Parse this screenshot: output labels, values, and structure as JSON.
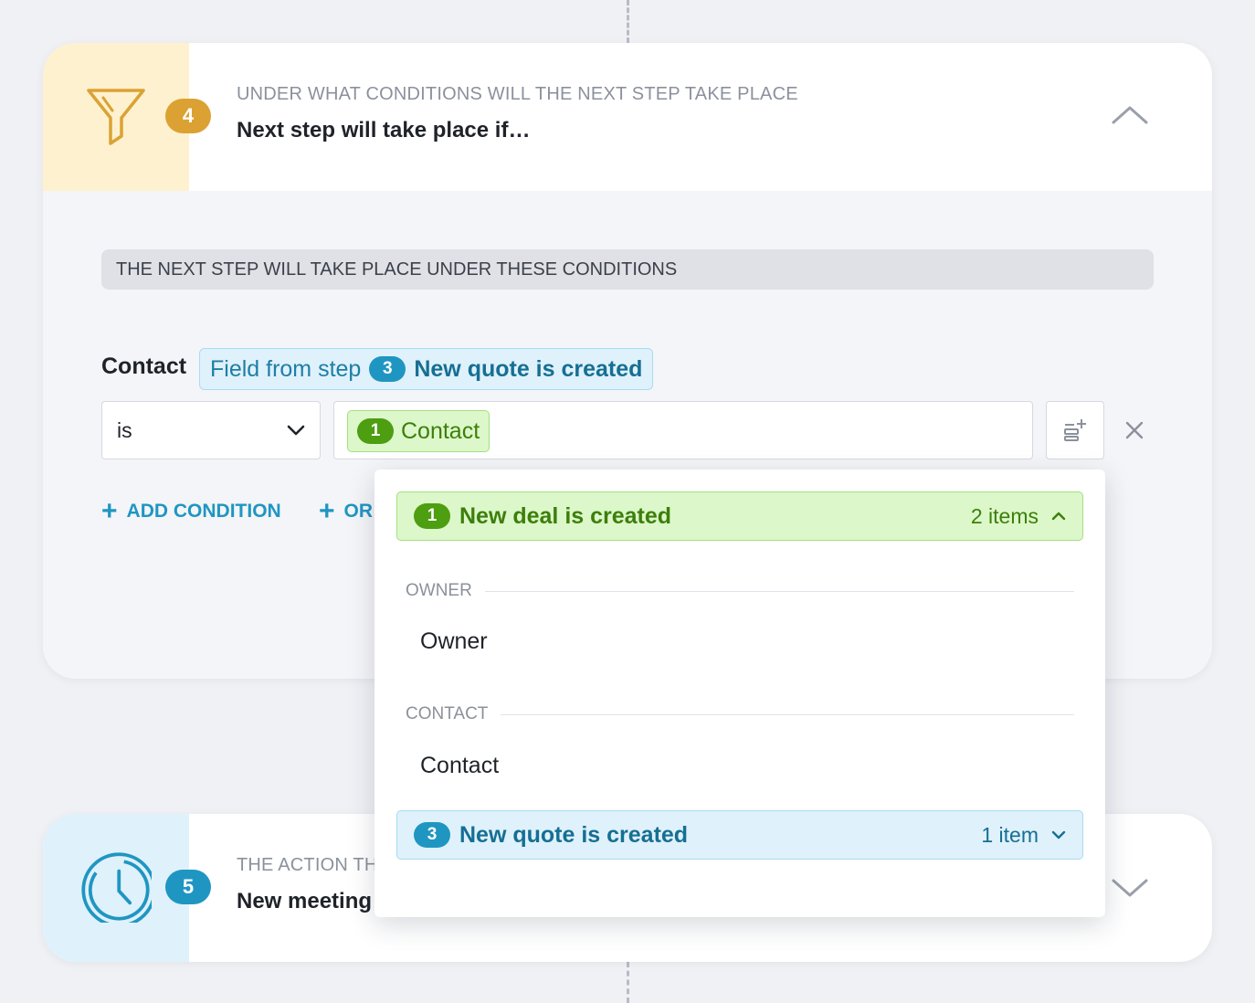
{
  "step4": {
    "number": "4",
    "icon": "funnel-icon",
    "subtitle": "UNDER WHAT CONDITIONS WILL THE NEXT STEP TAKE PLACE",
    "title": "Next step will take place if…",
    "section_header": "THE NEXT STEP WILL TAKE PLACE UNDER THESE CONDITIONS",
    "condition": {
      "field_label": "Contact",
      "field_source_prefix": "Field from step",
      "field_source_step": "3",
      "field_source_name": "New quote is created",
      "operator": "is",
      "value_step": "1",
      "value_label": "Contact"
    },
    "add_condition_label": "ADD CONDITION",
    "or_label": "OR"
  },
  "dropdown": {
    "group1": {
      "step": "1",
      "title": "New deal is created",
      "count": "2 items",
      "sections": [
        {
          "label": "OWNER",
          "item": "Owner"
        },
        {
          "label": "CONTACT",
          "item": "Contact"
        }
      ]
    },
    "group2": {
      "step": "3",
      "title": "New quote is created",
      "count": "1 item"
    }
  },
  "step5": {
    "number": "5",
    "icon": "clock-icon",
    "subtitle": "THE ACTION TH",
    "title": "New meeting"
  },
  "colors": {
    "accent_blue": "#1f96c2",
    "accent_gold": "#dba233",
    "accent_green": "#4d9e10",
    "background": "#f0f1f5"
  }
}
